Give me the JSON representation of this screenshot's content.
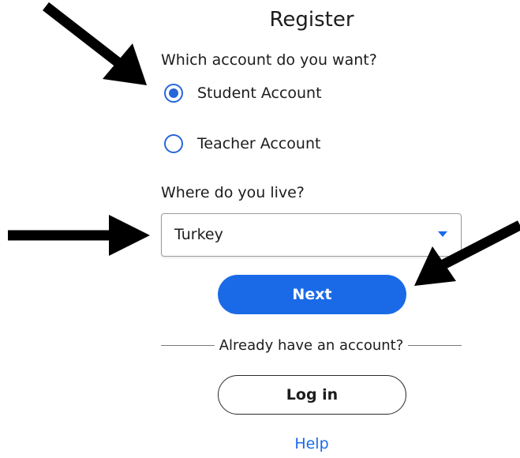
{
  "register": {
    "title": "Register",
    "account_question": "Which account do you want?",
    "account_options": [
      {
        "label": "Student Account",
        "selected": true
      },
      {
        "label": "Teacher Account",
        "selected": false
      }
    ],
    "country_question": "Where do you live?",
    "country_value": "Turkey",
    "next_label": "Next",
    "already_text": "Already have an account?",
    "login_label": "Log in",
    "help_label": "Help"
  },
  "colors": {
    "accent": "#1a6ae8",
    "text": "#1c1c1c",
    "annotation_arrows": "#000000"
  },
  "annotations": {
    "arrow_count": 3,
    "arrow_icon": "arrow-icon"
  }
}
